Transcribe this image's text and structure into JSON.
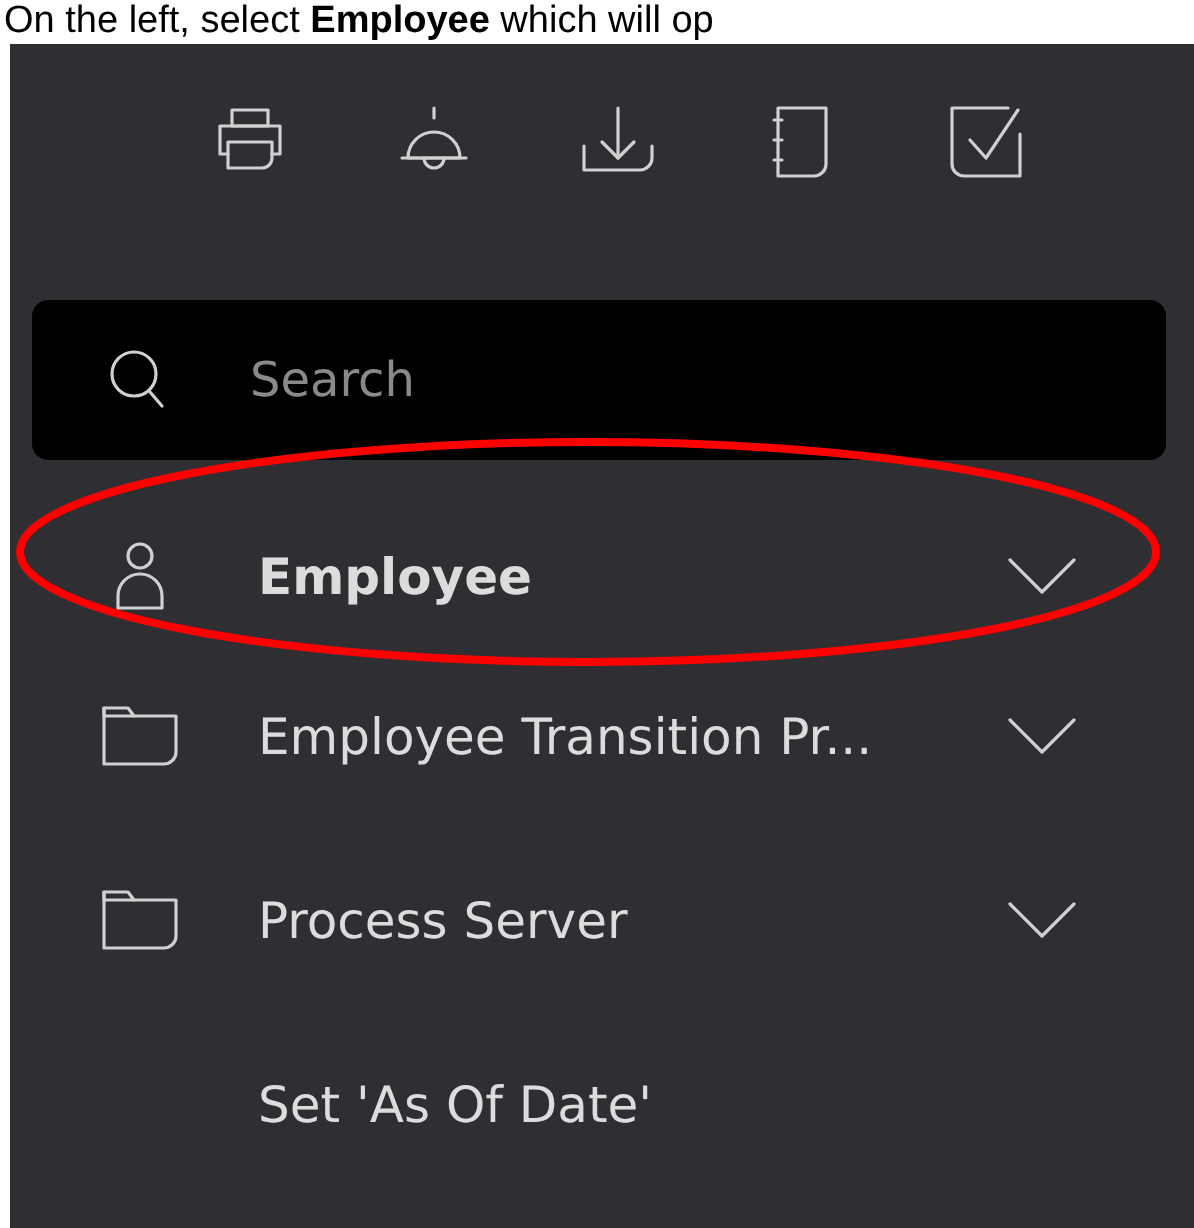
{
  "caption": "On the left, select **Employee** which will op",
  "toolbar": [
    {
      "kind": "printer"
    },
    {
      "kind": "bell"
    },
    {
      "kind": "download"
    },
    {
      "kind": "notebook"
    },
    {
      "kind": "checkbox"
    }
  ],
  "search": {
    "placeholder": "Search"
  },
  "menu_items": [
    {
      "label": "Employee",
      "kind": "person",
      "expanded": false,
      "highlighted": true
    },
    {
      "label": "Employee Transition Pr...",
      "kind": "folder",
      "expanded": false,
      "highlighted": false
    },
    {
      "label": "Process Server",
      "kind": "folder",
      "expanded": false,
      "highlighted": false
    },
    {
      "label": "Set 'As Of Date'",
      "kind": "plain",
      "highlighted": false
    }
  ]
}
